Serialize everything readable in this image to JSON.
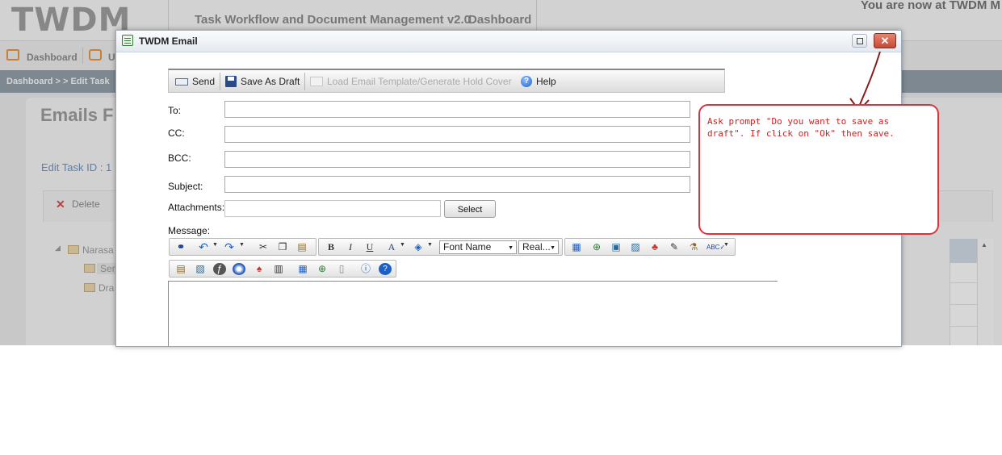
{
  "background_app": {
    "logo": "TWDM",
    "app_title": "Task Workflow and Document Management v2.0",
    "header_dashboard": "Dashboard",
    "user_info": "You are now at TWDM M",
    "nav": {
      "dashboard": "Dashboard",
      "second_item": "U"
    },
    "breadcrumb": "Dashboard > > Edit Task",
    "panel_title": "Emails F",
    "edit_task_label": "Edit Task ID : 1",
    "toolbar": {
      "delete": "Delete"
    },
    "tree": {
      "root": "Narasa",
      "sent": "Sen",
      "drafts": "Dra"
    }
  },
  "modal": {
    "title": "TWDM Email",
    "toolbar": {
      "send": "Send",
      "save_as_draft": "Save As Draft",
      "load_template": "Load Email Template/Generate Hold Cover",
      "help": "Help"
    },
    "fields": {
      "to_label": "To:",
      "cc_label": "CC:",
      "bcc_label": "BCC:",
      "subject_label": "Subject:",
      "attachments_label": "Attachments:",
      "select_button": "Select",
      "message_label": "Message:"
    },
    "editor": {
      "font_name": "Font Name",
      "font_size": "Real..."
    }
  },
  "annotation": {
    "text": "Ask prompt \"Do you want to save as\ndraft\". If click on \"Ok\" then save.",
    "color": "#d42020"
  },
  "icons": [
    "send-icon",
    "save-icon",
    "template-icon",
    "help-icon",
    "find-icon",
    "undo-icon",
    "redo-icon",
    "cut-icon",
    "copy-icon",
    "paste-icon",
    "bold-icon",
    "italic-icon",
    "underline-icon",
    "font-color-icon",
    "highlight-icon",
    "table-icon",
    "link-icon",
    "image-icon",
    "spellcheck-icon"
  ]
}
